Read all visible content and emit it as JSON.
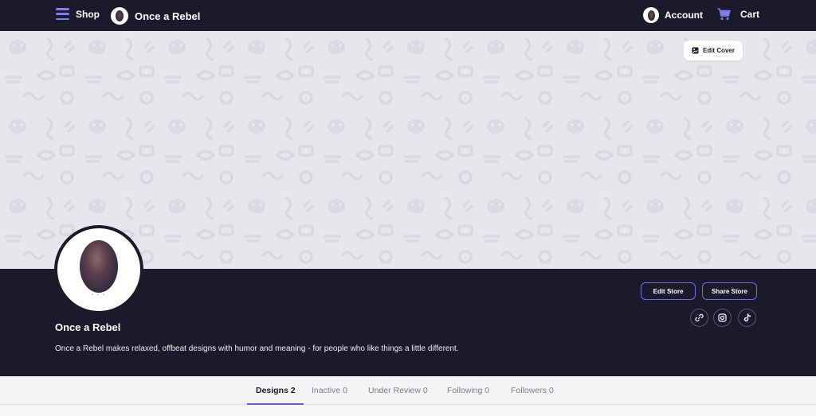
{
  "nav": {
    "shop_label": "Shop",
    "brand_name": "Once a Rebel",
    "account_label": "Account",
    "cart_label": "Cart"
  },
  "cover": {
    "edit_cover_label": "Edit Cover"
  },
  "profile": {
    "store_name": "Once a Rebel",
    "description": "Once a Rebel makes relaxed, offbeat designs with humor and meaning - for people who like things a little different.",
    "edit_store_label": "Edit Store",
    "share_store_label": "Share Store",
    "socials": [
      "link-icon",
      "instagram-icon",
      "tiktok-icon"
    ]
  },
  "tabs": [
    {
      "label": "Designs 2",
      "active": true
    },
    {
      "label": "Inactive 0",
      "active": false
    },
    {
      "label": "Under Review 0",
      "active": false
    },
    {
      "label": "Following 0",
      "active": false
    },
    {
      "label": "Followers 0",
      "active": false
    }
  ],
  "colors": {
    "nav_bg": "#1a1a2b",
    "accent": "#6a6ff0",
    "cover_bg": "#e7e6ec"
  }
}
